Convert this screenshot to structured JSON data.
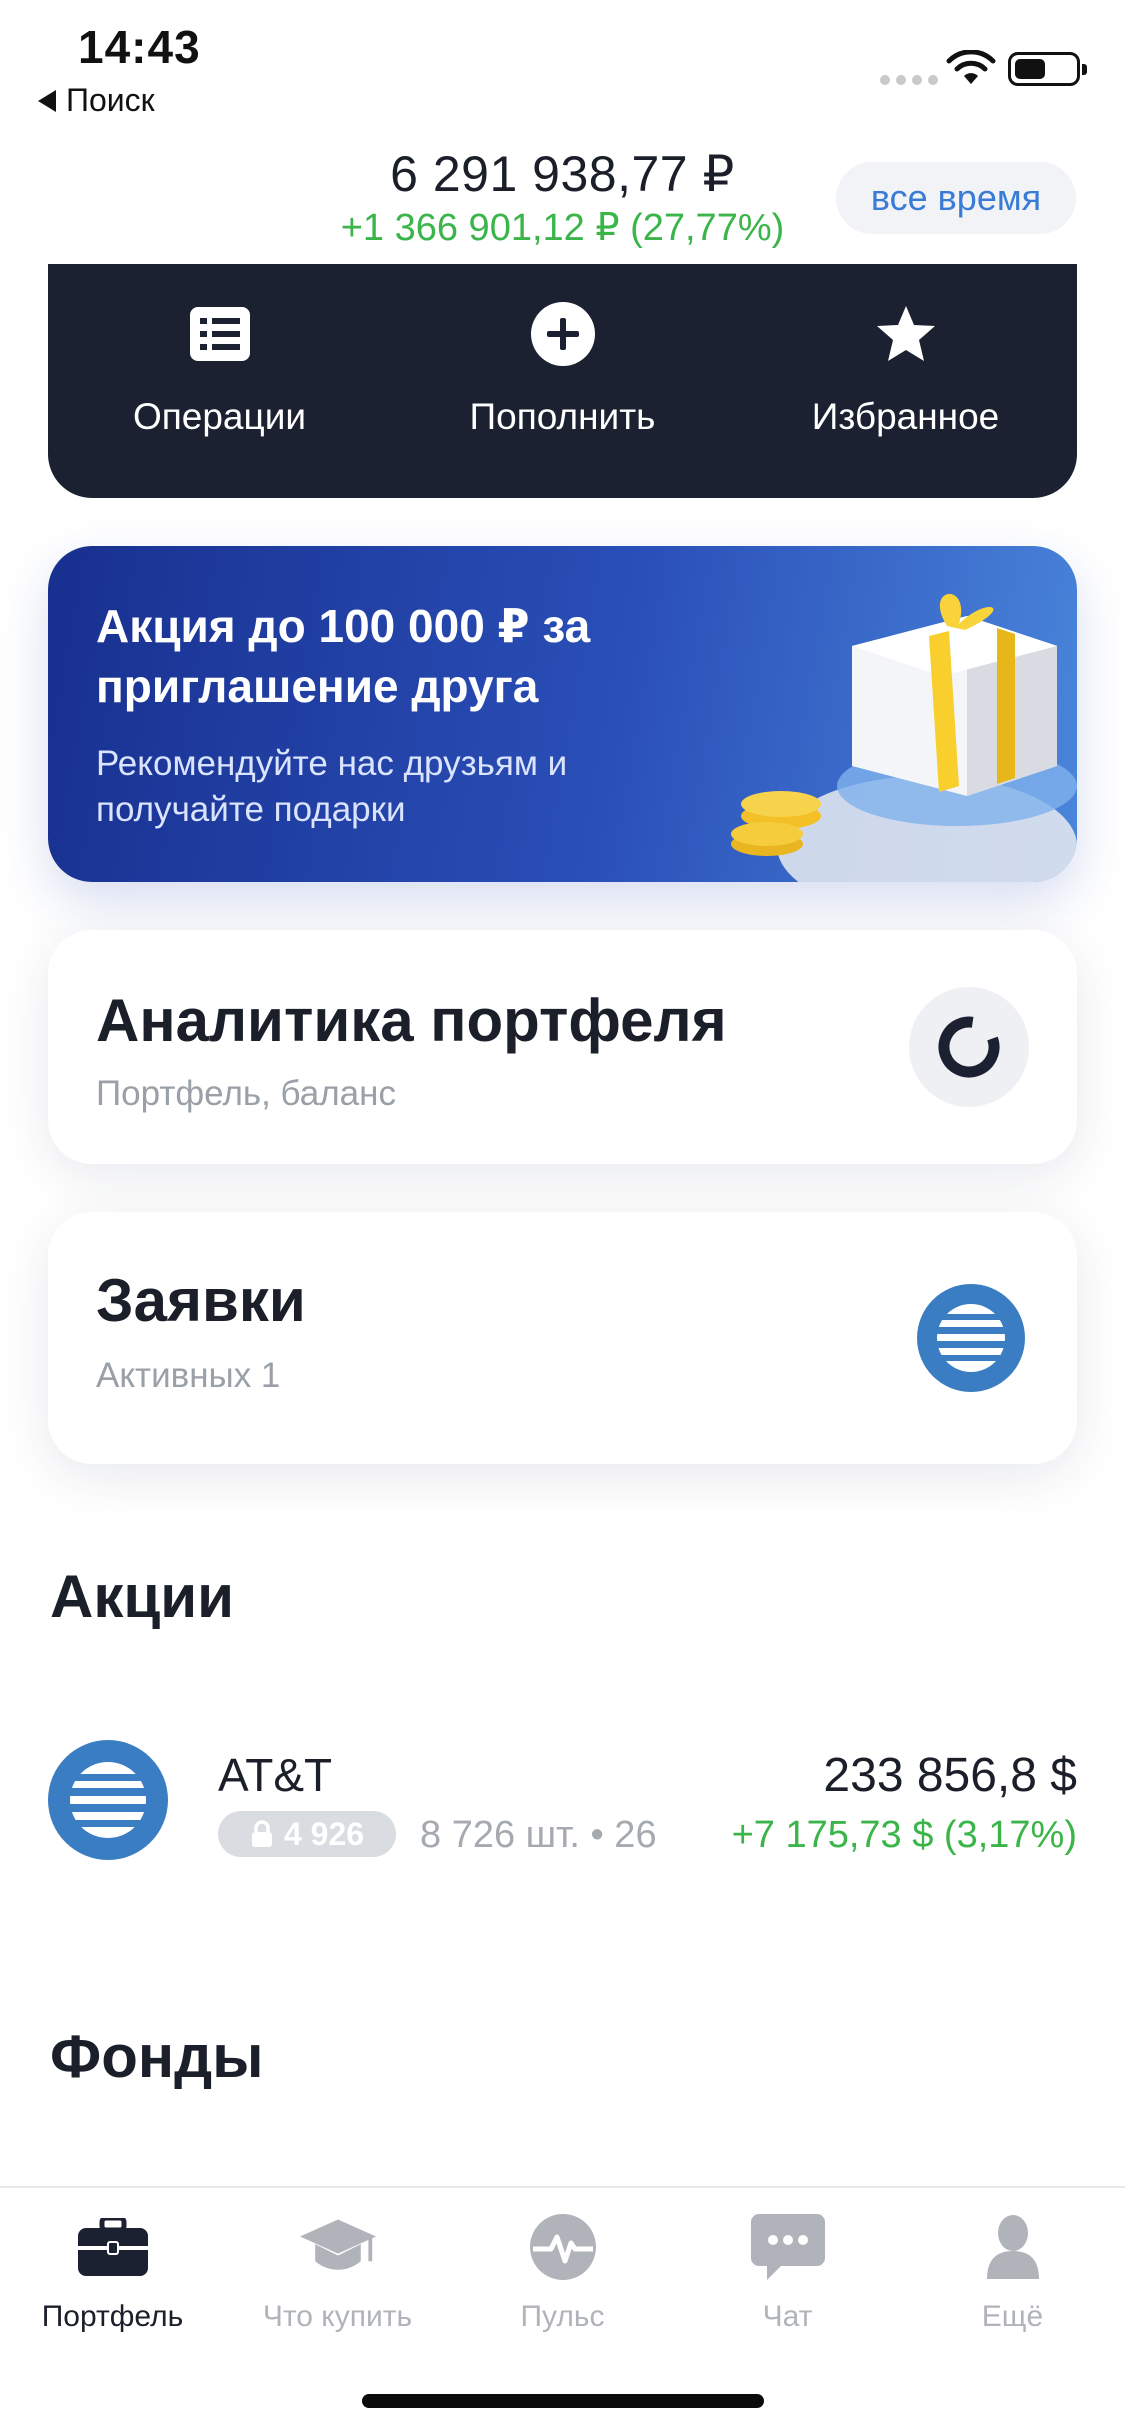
{
  "status_bar": {
    "time": "14:43",
    "back_label": "Поиск"
  },
  "header": {
    "balance": "6 291 938,77 ₽",
    "balance_change": "+1 366 901,12 ₽ (27,77%)",
    "period": "все время"
  },
  "actions": [
    {
      "label": "Операции",
      "icon": "list-icon"
    },
    {
      "label": "Пополнить",
      "icon": "plus-circle-icon"
    },
    {
      "label": "Избранное",
      "icon": "star-icon"
    }
  ],
  "promo": {
    "title": "Акция до 100 000 ₽ за приглашение друга",
    "subtitle": "Рекомендуйте нас друзьям и получайте подарки"
  },
  "analytics": {
    "title": "Аналитика портфеля",
    "subtitle": "Портфель, баланс"
  },
  "orders": {
    "title": "Заявки",
    "subtitle": "Активных 1"
  },
  "stocks": {
    "title": "Акции",
    "items": [
      {
        "name": "AT&T",
        "locked_qty": "4 926",
        "qty": "8 726 шт. • 26",
        "value": "233 856,8 $",
        "change": "+7 175,73 $ (3,17%)"
      }
    ]
  },
  "funds": {
    "title": "Фонды"
  },
  "tabbar": {
    "items": [
      {
        "label": "Портфель",
        "icon": "briefcase-icon",
        "active": true
      },
      {
        "label": "Что купить",
        "icon": "graduation-cap-icon",
        "active": false
      },
      {
        "label": "Пульс",
        "icon": "pulse-icon",
        "active": false
      },
      {
        "label": "Чат",
        "icon": "chat-icon",
        "active": false
      },
      {
        "label": "Ещё",
        "icon": "profile-icon",
        "active": false
      }
    ]
  },
  "colors": {
    "accent": "#3a7bd5",
    "positive": "#3bb54a",
    "dark_card": "#1b2130"
  }
}
